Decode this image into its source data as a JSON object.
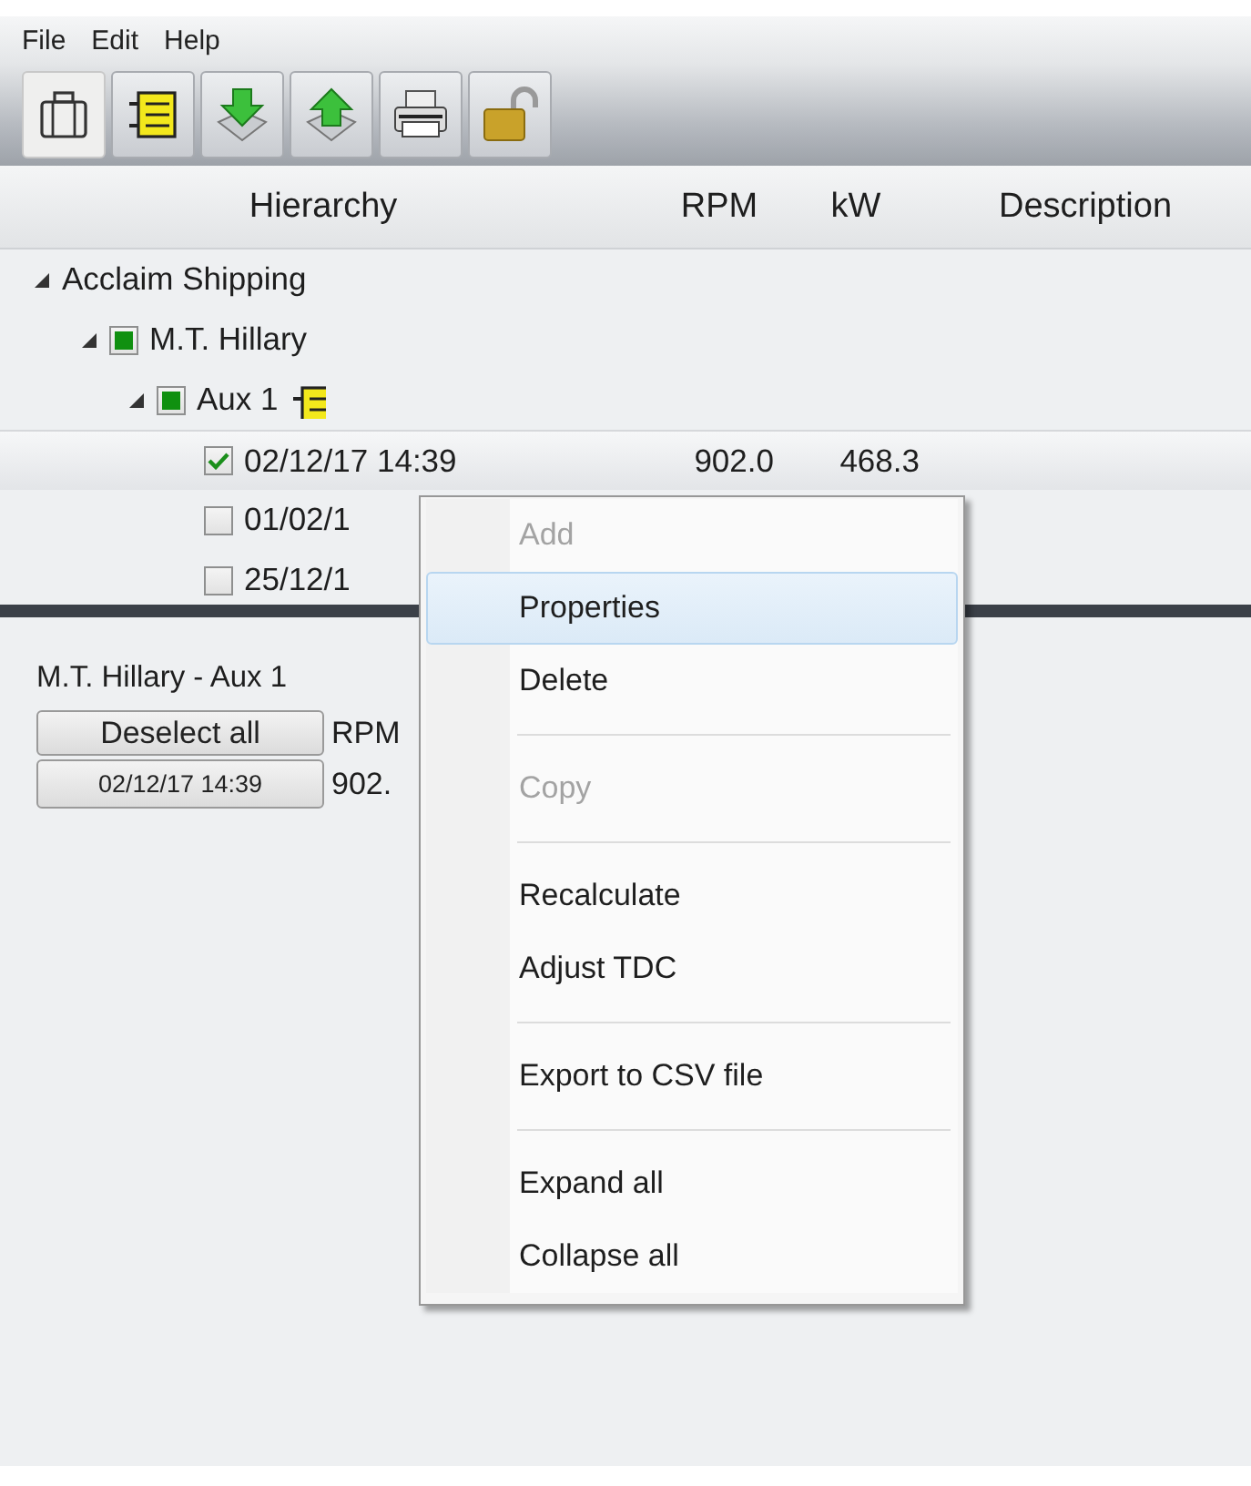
{
  "menu_bar": [
    {
      "label": "File"
    },
    {
      "label": "Edit"
    },
    {
      "label": "Help"
    }
  ],
  "toolbar": [
    {
      "kind": "briefcase",
      "selected": true
    },
    {
      "kind": "list",
      "selected": false
    },
    {
      "kind": "import",
      "selected": false
    },
    {
      "kind": "export",
      "selected": false
    },
    {
      "kind": "print",
      "selected": false
    },
    {
      "kind": "lock",
      "selected": false
    }
  ],
  "tree": {
    "columns": [
      "Hierarchy",
      "RPM",
      "kW",
      "Description"
    ],
    "nodes": [
      {
        "kind": "company",
        "label": "Acclaim Shipping",
        "expanded": true,
        "children": [
          {
            "kind": "vessel",
            "label": "M.T. Hillary",
            "checked": true,
            "expanded": true,
            "children": [
              {
                "kind": "engine",
                "label": "Aux 1",
                "checked": true,
                "expanded": true,
                "children": [
                  {
                    "kind": "measurement",
                    "label": "02/12/17  14:39",
                    "rpm": "902.0",
                    "kw": "468.3",
                    "checked": true,
                    "selected": true
                  },
                  {
                    "kind": "measurement",
                    "label": "01/02/1",
                    "checked": false,
                    "selected": false
                  },
                  {
                    "kind": "measurement",
                    "label": "25/12/1",
                    "checked": false,
                    "selected": false
                  }
                ]
              }
            ]
          }
        ]
      }
    ]
  },
  "detail": {
    "title": "M.T. Hillary - Aux 1",
    "deselect_button": "Deselect all",
    "column": "RPM",
    "rows": [
      {
        "label": "02/12/17  14:39",
        "rpm": "902."
      }
    ]
  },
  "context_menu": [
    {
      "kind": "item",
      "label": "Add",
      "disabled": true,
      "selected": false
    },
    {
      "kind": "item",
      "label": "Properties",
      "disabled": false,
      "selected": true
    },
    {
      "kind": "item",
      "label": "Delete",
      "disabled": false,
      "selected": false
    },
    {
      "kind": "separator"
    },
    {
      "kind": "item",
      "label": "Copy",
      "disabled": true,
      "selected": false
    },
    {
      "kind": "separator"
    },
    {
      "kind": "item",
      "label": "Recalculate",
      "disabled": false,
      "selected": false
    },
    {
      "kind": "item",
      "label": "Adjust TDC",
      "disabled": false,
      "selected": false
    },
    {
      "kind": "separator"
    },
    {
      "kind": "item",
      "label": "Export to CSV file",
      "disabled": false,
      "selected": false
    },
    {
      "kind": "separator"
    },
    {
      "kind": "item",
      "label": "Expand all",
      "disabled": false,
      "selected": false
    },
    {
      "kind": "item",
      "label": "Collapse all",
      "disabled": false,
      "selected": false
    }
  ]
}
